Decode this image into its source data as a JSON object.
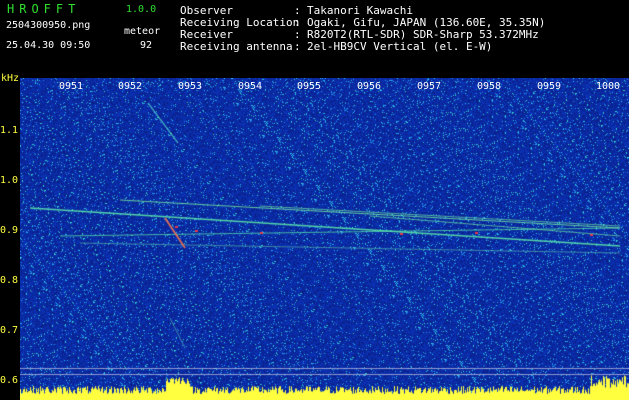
{
  "header": {
    "brand": "HROFFT",
    "version": "1.0.0",
    "filename": "2504300950.png",
    "datetime": "25.04.30 09:50",
    "meteor_label": "meteor",
    "meteor_count": "92"
  },
  "info": [
    {
      "label": "Observer",
      "value": "Takanori Kawachi"
    },
    {
      "label": "Receiving Location",
      "value": "Ogaki, Gifu, JAPAN (136.60E, 35.35N)"
    },
    {
      "label": "Receiver",
      "value": "R820T2(RTL-SDR) SDR-Sharp 53.372MHz"
    },
    {
      "label": "Receiving antenna",
      "value": "2el-HB9CV Vertical (el. E-W)"
    }
  ],
  "separator": ":",
  "axis": {
    "unit": "kHz",
    "y_ticks": [
      "1.1",
      "1.0",
      "0.9",
      "0.8",
      "0.7",
      "0.6"
    ],
    "x_ticks": [
      "0951",
      "0952",
      "0953",
      "0954",
      "0955",
      "0956",
      "0957",
      "0958",
      "0959",
      "1000"
    ]
  },
  "colors": {
    "title_green": "#2fe02f",
    "text_white": "#ffffff",
    "axis_yellow": "#ffff40",
    "background_blue": "#1a2fa8"
  }
}
